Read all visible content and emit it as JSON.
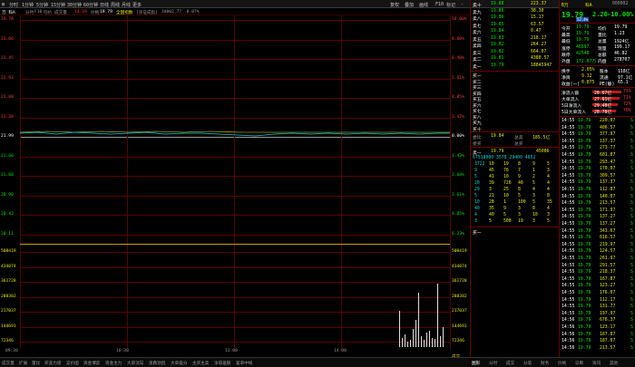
{
  "toolbar": {
    "tabs": [
      "分时",
      "1分钟",
      "5分钟",
      "15分钟",
      "30分钟",
      "60分钟",
      "日线",
      "周线",
      "月线",
      "更多"
    ],
    "right_items": [
      "复权",
      "叠加",
      "画线",
      "F10",
      "标记",
      "-"
    ]
  },
  "chart": {
    "sub_tabs": [
      "分时",
      "F10",
      "均价",
      "成交量"
    ],
    "time_label": "14:19",
    "price_label": "19.79",
    "index_label": "全国指数",
    "index_value": "10802.77 -0.07%",
    "price_ticks": [
      "24.78",
      "23.66",
      "23.45",
      "22.93",
      "22.80",
      "22.38",
      "21.99",
      "21.66",
      "21.60",
      "20.90",
      "20.42",
      "20.11"
    ],
    "pct_ticks": [
      "10.00%",
      "8.60%",
      "6.40%",
      "5.61%",
      "4.85%",
      "3.47%",
      "0.00%",
      "1.43%",
      "2.64%",
      "3.61%",
      "4.85%",
      "6.23%"
    ],
    "vol_ticks_left": [
      "508419",
      "434074",
      "361728",
      "288382",
      "217037",
      "144691",
      "72346"
    ],
    "vol_ticks_right": [
      "508419",
      "434074",
      "361728",
      "288382",
      "217037",
      "144691",
      "72346",
      "成交"
    ],
    "time_axis": [
      "09:30",
      "10:30",
      "13:00",
      "14:00"
    ],
    "sub_panel_tabs": [
      "成交量",
      "扩展",
      "量比",
      "买卖力道",
      "竞价图",
      "资金博弈",
      "资金主力",
      "大单流向",
      "涨跌动因",
      "大单差分",
      "主买主卖",
      "净值差额",
      "差单中线"
    ],
    "bottom_tabs_right": [
      "图形",
      "分时",
      "成交",
      "分笔",
      "财务",
      "价格",
      "诊断",
      "资讯",
      "其他"
    ]
  },
  "orderbook": {
    "sell": [
      {
        "label": "卖十",
        "price": "19.88",
        "vol": "223.37"
      },
      {
        "label": "卖九",
        "price": "19.86",
        "vol": "38.30"
      },
      {
        "label": "卖八",
        "price": "19.86",
        "vol": "15.17"
      },
      {
        "label": "卖七",
        "price": "19.85",
        "vol": "63.57"
      },
      {
        "label": "卖六",
        "price": "19.84",
        "vol": "0.47"
      },
      {
        "label": "卖五",
        "price": "19.83",
        "vol": "218.17"
      },
      {
        "label": "卖四",
        "price": "19.82",
        "vol": "264.27"
      },
      {
        "label": "卖三",
        "price": "19.82",
        "vol": "664.07"
      },
      {
        "label": "卖二",
        "price": "19.81",
        "vol": "4380.57"
      },
      {
        "label": "卖一",
        "price": "19.79",
        "vol": "18845947"
      }
    ],
    "buy_labels": [
      "买一",
      "买二",
      "买三",
      "买四",
      "买五",
      "买六",
      "买七",
      "买八",
      "买九",
      "买十"
    ],
    "trade": {
      "price_label": "委比",
      "price": "19.84",
      "total_label": "总卖",
      "total": "185.5亿",
      "buy_label": "委买",
      "buy_total_label": "总买"
    },
    "queue_header": {
      "label": "卖一",
      "price": "19.79",
      "qty": "45006"
    },
    "queue_line1": "67518000 3578 29400 4652",
    "queue_rows": [
      [
        "3722",
        "10",
        "19",
        "8",
        "9",
        "5"
      ],
      [
        "9",
        "45",
        "76",
        "7",
        "1",
        "3"
      ],
      [
        "5",
        "41",
        "10",
        "9",
        "2",
        "4"
      ],
      [
        "20",
        "39",
        "726",
        "40",
        "5",
        "4"
      ],
      [
        "29",
        "3",
        "25",
        "8",
        "4",
        "4"
      ],
      [
        "5",
        "21",
        "10",
        "5",
        "3",
        "8"
      ],
      [
        "10",
        "28",
        "1",
        "100",
        "5",
        "35"
      ],
      [
        "40",
        "35",
        "9",
        "3",
        "8",
        "4"
      ],
      [
        "4",
        "40",
        "5",
        "3",
        "10",
        "3"
      ],
      [
        "3",
        "5",
        "500",
        "19",
        "3",
        "5"
      ]
    ],
    "buy_queue_label": "买一"
  },
  "stock": {
    "name_left": "B万",
    "name_right": "科A",
    "code": "000002",
    "price": "19.79",
    "change": "2.20",
    "change_pct": "-10.00%",
    "badge": "52.4%",
    "stats": [
      {
        "k": "今开",
        "v": "19.79",
        "k2": "均价",
        "v2": "19.79"
      },
      {
        "k": "最高",
        "v": "19.79",
        "k2": "量比",
        "v2": "1.23"
      },
      {
        "k": "最低",
        "v": "19.79",
        "k2": "总量",
        "v2": "1924亿"
      },
      {
        "k": "涨停",
        "v": "46597",
        "k2": "现量",
        "v2": "199.17"
      },
      {
        "k": "跌停",
        "v": "42548",
        "k2": "总额",
        "v2": "46.82"
      },
      {
        "k": "外盘",
        "v": "172.87万",
        "k2": "内盘",
        "v2": "278707"
      }
    ],
    "stats2": [
      {
        "k": "换手",
        "v": "2.05%",
        "k2": "股本",
        "v2": "118亿"
      },
      {
        "k": "净资",
        "v": "9.12",
        "k2": "流通",
        "v2": "97.1亿"
      },
      {
        "k": "收益(一)",
        "v": "0.875",
        "k2": "PE(静)",
        "v2": "65.1"
      }
    ],
    "flows": [
      {
        "k": "净流入额",
        "v": "28.67亿",
        "p": "73%"
      },
      {
        "k": "大单流入",
        "v": "27.61亿",
        "p": "71%"
      },
      {
        "k": "5日净流入",
        "v": "29.48亿",
        "p": "72%"
      },
      {
        "k": "5日大单流入",
        "v": "28.78亿",
        "p": "70%"
      }
    ],
    "ticks": [
      {
        "t": "14:55",
        "p": "19.79",
        "v": "220.07"
      },
      {
        "t": "14:55",
        "p": "19.79",
        "v": "406.57"
      },
      {
        "t": "14:55",
        "p": "19.79",
        "v": "377.97"
      },
      {
        "t": "14:55",
        "p": "19.79",
        "v": "137.37"
      },
      {
        "t": "14:55",
        "p": "19.79",
        "v": "273.77"
      },
      {
        "t": "14:55",
        "p": "19.79",
        "v": "601.87"
      },
      {
        "t": "14:55",
        "p": "19.79",
        "v": "293.47"
      },
      {
        "t": "14:55",
        "p": "19.79",
        "v": "170.07"
      },
      {
        "t": "14:55",
        "p": "19.79",
        "v": "309.57"
      },
      {
        "t": "14:55",
        "p": "19.79",
        "v": "137.37"
      },
      {
        "t": "14:55",
        "p": "19.79",
        "v": "112.87"
      },
      {
        "t": "14:55",
        "p": "19.79",
        "v": "140.07"
      },
      {
        "t": "14:55",
        "p": "19.79",
        "v": "213.57"
      },
      {
        "t": "14:55",
        "p": "19.79",
        "v": "171.97"
      },
      {
        "t": "14:55",
        "p": "19.79",
        "v": "137.27"
      },
      {
        "t": "14:55",
        "p": "19.79",
        "v": "137.27"
      },
      {
        "t": "14:55",
        "p": "19.79",
        "v": "343.67"
      },
      {
        "t": "14:55",
        "p": "19.79",
        "v": "616.57"
      },
      {
        "t": "14:55",
        "p": "19.79",
        "v": "219.97"
      },
      {
        "t": "14:55",
        "p": "19.79",
        "v": "124.57"
      },
      {
        "t": "14:55",
        "p": "19.79",
        "v": "261.97"
      },
      {
        "t": "14:55",
        "p": "19.79",
        "v": "291.57"
      },
      {
        "t": "14:55",
        "p": "19.79",
        "v": "218.37"
      },
      {
        "t": "14:55",
        "p": "19.79",
        "v": "167.87"
      },
      {
        "t": "14:55",
        "p": "19.79",
        "v": "123.27"
      },
      {
        "t": "14:55",
        "p": "19.79",
        "v": "176.07"
      },
      {
        "t": "14:55",
        "p": "19.79",
        "v": "112.17"
      },
      {
        "t": "14:55",
        "p": "19.79",
        "v": "131.77"
      },
      {
        "t": "14:55",
        "p": "19.79",
        "v": "197.97"
      },
      {
        "t": "14:56",
        "p": "19.79",
        "v": "676.37"
      },
      {
        "t": "14:56",
        "p": "19.79",
        "v": "123.17"
      },
      {
        "t": "14:56",
        "p": "19.79",
        "v": "167.87"
      },
      {
        "t": "14:56",
        "p": "19.79",
        "v": "187.07"
      },
      {
        "t": "14:56",
        "p": "19.79",
        "v": "213.57"
      }
    ]
  },
  "colors": {
    "up": "#ff3b3b",
    "down": "#00e600",
    "grid": "#5a0000",
    "price_line": "#ffffff",
    "avg_line": "#e8e800"
  }
}
